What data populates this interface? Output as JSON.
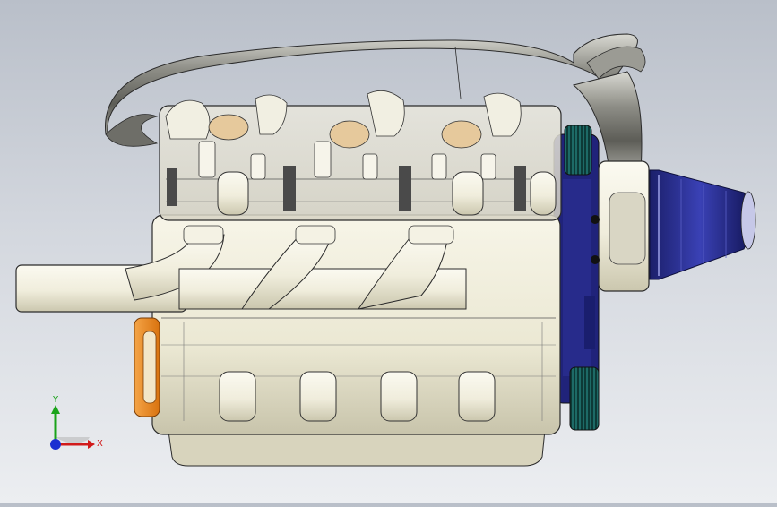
{
  "viewport": {
    "background_top": "#b9bfc9",
    "background_bottom": "#eceef1",
    "model_colors": {
      "block": "#efecda",
      "block_shade": "#c9c5ad",
      "exhaust": "#f4f2e4",
      "intake_pipe": "#8a8a84",
      "filter": "#2a2f8c",
      "pulley": "#1f6f6a",
      "flange": "#e8891e",
      "transparent_head": "#e2e0d6",
      "edge": "#2b2b2b"
    }
  },
  "triad": {
    "x_label": "X",
    "y_label": "Y",
    "x_color": "#d11a1a",
    "y_color": "#1aa31a",
    "z_color": "#1a2fd1"
  }
}
